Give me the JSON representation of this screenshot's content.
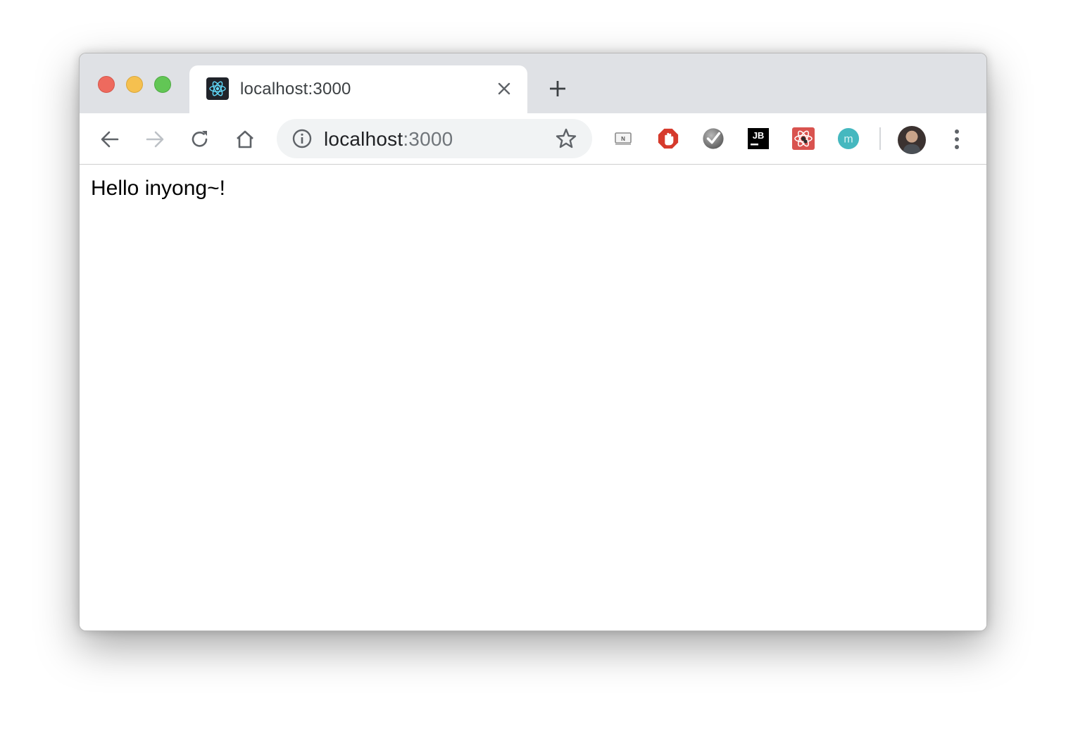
{
  "window": {
    "traffic_lights": [
      "close",
      "minimize",
      "maximize"
    ]
  },
  "tab": {
    "title": "localhost:3000",
    "favicon": "react-logo-icon"
  },
  "toolbar": {
    "buttons": [
      "back-icon",
      "forward-icon",
      "reload-icon",
      "home-icon"
    ],
    "forward_enabled": false
  },
  "omnibox": {
    "host": "localhost",
    "port": ":3000",
    "info_icon": "info-icon",
    "bookmark_icon": "star-icon"
  },
  "extensions": [
    "notion-web-clipper-icon",
    "adblock-icon",
    "checkmark-extension-icon",
    "jetbrains-icon",
    "react-devtools-icon",
    "mercury-reader-icon"
  ],
  "profile": {
    "icon": "profile-avatar"
  },
  "page": {
    "text": "Hello inyong~!"
  },
  "colors": {
    "tabstrip": "#dfe1e5",
    "close": "#ee6a5e",
    "minimize": "#f5c04f",
    "maximize": "#62c655"
  }
}
